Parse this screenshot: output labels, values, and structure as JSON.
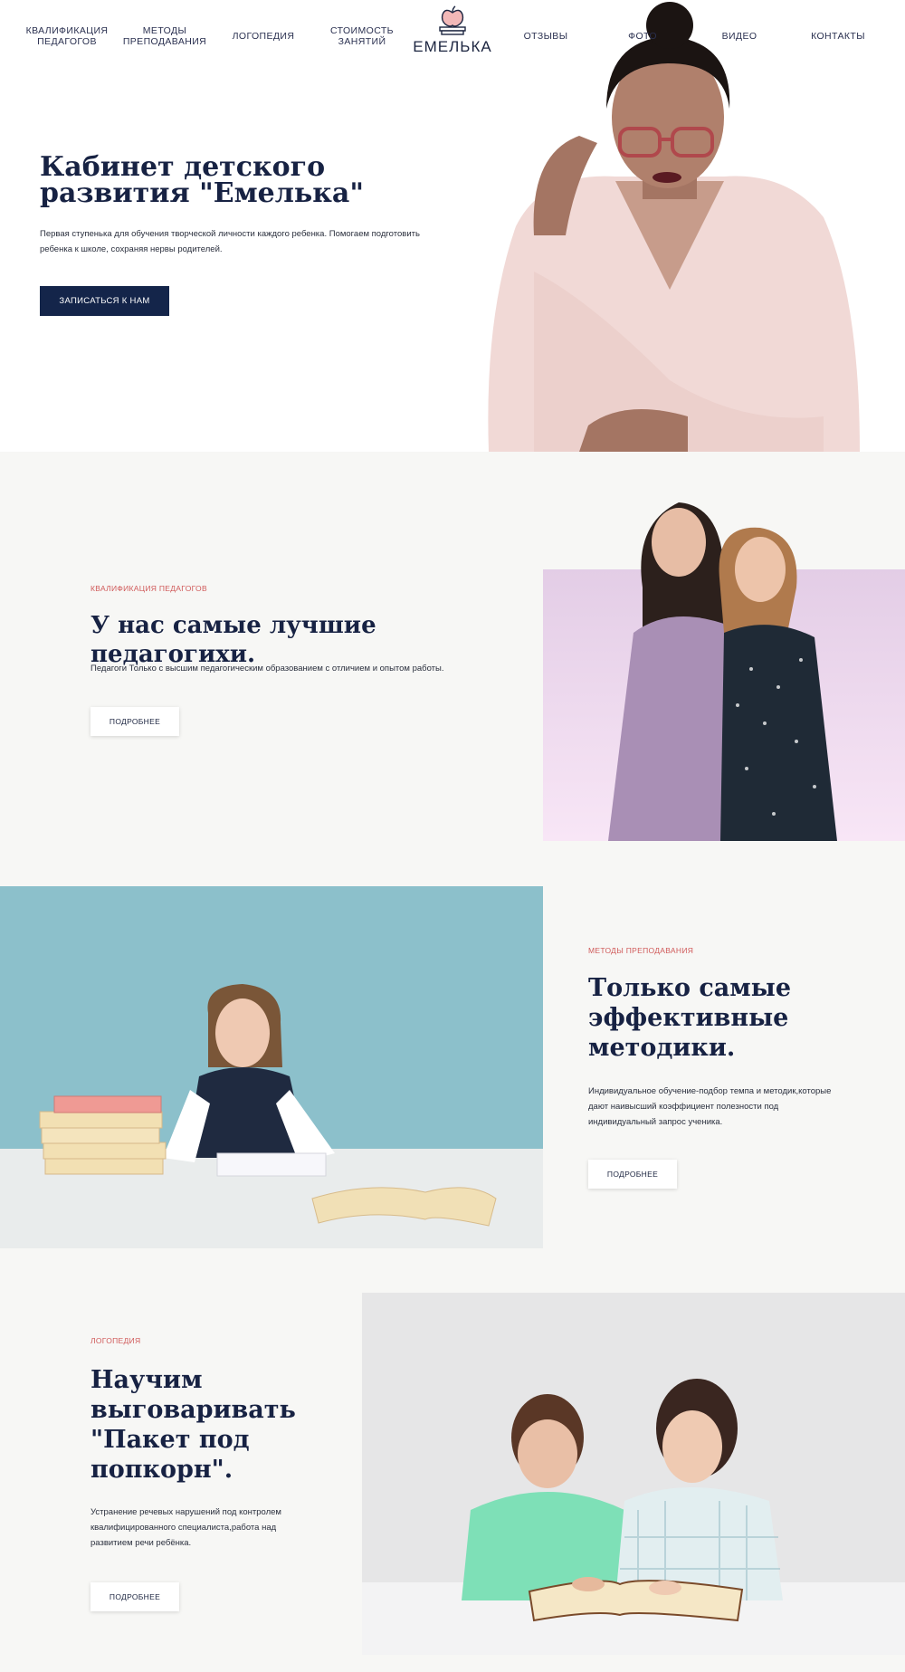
{
  "nav": {
    "items": [
      {
        "label": "КВАЛИФИКАЦИЯ\nПЕДАГОГОВ"
      },
      {
        "label": "МЕТОДЫ\nПРЕПОДАВАНИЯ"
      },
      {
        "label": "ЛОГОПЕДИЯ"
      },
      {
        "label": "СТОИМОСТЬ\nЗАНЯТИЙ"
      },
      {
        "label": "ОТЗЫВЫ"
      },
      {
        "label": "ФОТО"
      },
      {
        "label": "ВИДЕО"
      },
      {
        "label": "КОНТАКТЫ"
      }
    ],
    "logo_text": "ЕМЕЛЬКА"
  },
  "hero": {
    "title": "Кабинет детского развития \"Емелька\"",
    "text": "Первая ступенька для обучения творческой личности каждого ребенка. Помогаем подготовить ребенка к школе, сохраняя нервы родителей.",
    "button": "ЗАПИСАТЬСЯ К НАМ"
  },
  "qualification": {
    "eyebrow": "КВАЛИФИКАЦИЯ ПЕДАГОГОВ",
    "title": "У нас самые лучшие педагогихи.",
    "text": "Педагоги Только с высшим педагогическим образованием с отличием и опытом работы.",
    "button": "ПОДРОБНЕЕ"
  },
  "methods": {
    "eyebrow": "МЕТОДЫ ПРЕПОДАВАНИЯ",
    "title": "Только самые эффективные методики.",
    "text": "Индивидуальное обучение-подбор темпа и методик,которые дают наивысший коэффициент полезности под индивидуальный запрос ученика.",
    "button": "ПОДРОБНЕЕ"
  },
  "speech": {
    "eyebrow": "ЛОГОПЕДИЯ",
    "title": "Научим выговаривать \"Пакет под попкорн\".",
    "text": "Устранение речевых нарушений под контролем квалифицированного специалиста,работа над развитием речи ребёнка.",
    "button": "ПОДРОБНЕЕ"
  },
  "colors": {
    "accent": "#14254a",
    "eyebrow": "#d05a5a",
    "section_bg": "#f7f7f5"
  }
}
